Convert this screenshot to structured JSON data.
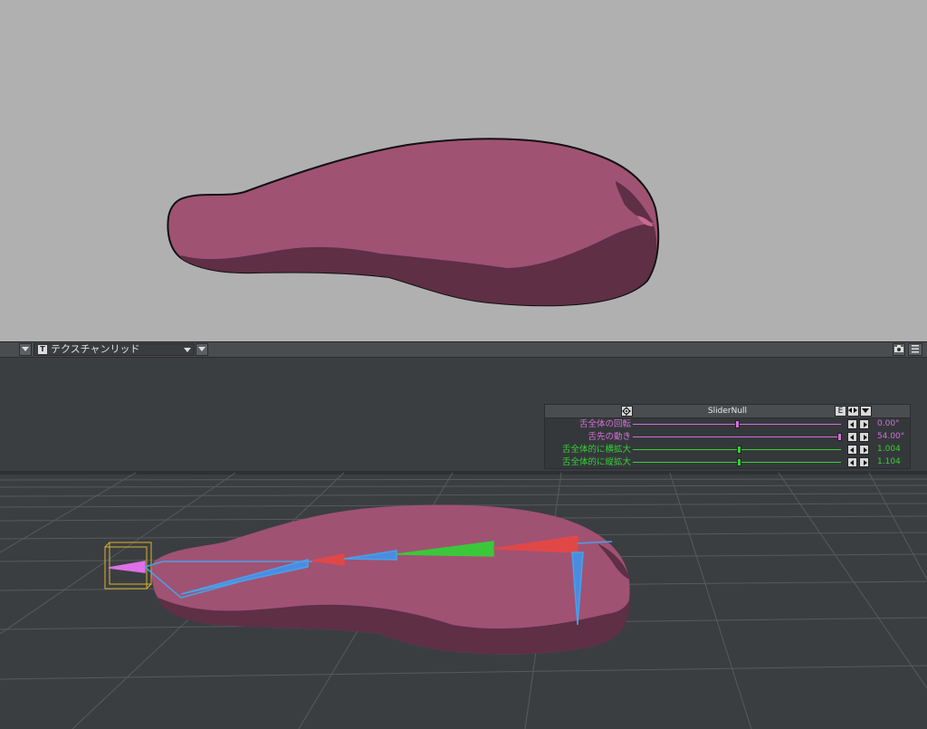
{
  "toolbar": {
    "view_mode_label": "テクスチャンリッド",
    "view_mode_icon": "T"
  },
  "slider_panel": {
    "title": "SliderNull",
    "e_button_label": "E",
    "rows": [
      {
        "label": "舌全体の回転",
        "value": "0.00°",
        "position": 0.5,
        "color": "#d070d8"
      },
      {
        "label": "舌先の動き",
        "value": "54.00°",
        "position": 1.0,
        "color": "#d070d8"
      },
      {
        "label": "舌全体的に横拡大",
        "value": "1.004",
        "position": 0.51,
        "color": "#35d035"
      },
      {
        "label": "舌全体的に縦拡大",
        "value": "1.104",
        "position": 0.51,
        "color": "#35d035"
      }
    ]
  },
  "colors": {
    "tongue_light": "#a05273",
    "tongue_dark": "#5e2f45",
    "render_bg": "#b0b0b0",
    "viewport_bg": "#3b3e41"
  },
  "icons": {
    "toolbar_left": "dropdown-arrow-icon",
    "camera": "camera-icon",
    "menu": "list-menu-icon",
    "move": "move-icon"
  }
}
